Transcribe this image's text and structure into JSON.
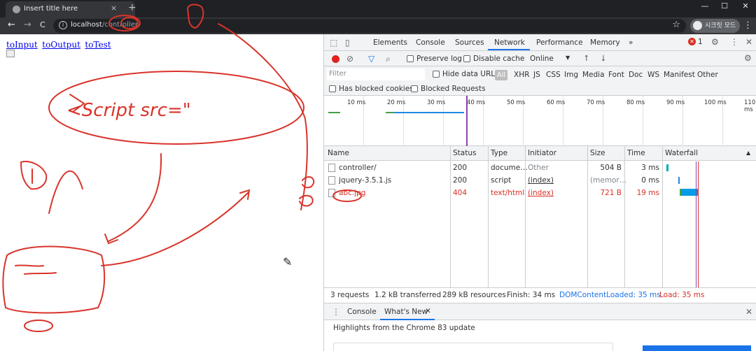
{
  "browser": {
    "tab_title": "Insert title here",
    "tab_close": "×",
    "new_tab": "+",
    "window_controls": [
      "—",
      "☐",
      "✕"
    ],
    "back": "←",
    "forward": "→",
    "reload": "C",
    "url_host": "localhost",
    "url_path": "/controller/",
    "star": "☆",
    "profile_label": "시크릿 모드",
    "menu": "⋮"
  },
  "page": {
    "links": [
      "toInput",
      "toOutput",
      "toTest"
    ]
  },
  "devtools": {
    "tabs": [
      "Elements",
      "Console",
      "Sources",
      "Network",
      "Performance",
      "Memory",
      "»"
    ],
    "selected_tab": "Network",
    "error_count": "1",
    "toolbar": {
      "preserve_log": "Preserve log",
      "disable_cache": "Disable cache",
      "throttle": "Online",
      "throttle_arrow": "▼"
    },
    "filter": {
      "placeholder": "Filter",
      "hide_data_urls": "Hide data URLs",
      "all": "All",
      "types": [
        "XHR",
        "JS",
        "CSS",
        "Img",
        "Media",
        "Font",
        "Doc",
        "WS",
        "Manifest",
        "Other"
      ],
      "has_blocked_cookies": "Has blocked cookies",
      "blocked_requests": "Blocked Requests"
    },
    "timeline_ticks": [
      "10 ms",
      "20 ms",
      "30 ms",
      "40 ms",
      "50 ms",
      "60 ms",
      "70 ms",
      "80 ms",
      "90 ms",
      "100 ms",
      "110 ms"
    ],
    "columns": [
      "Name",
      "Status",
      "Type",
      "Initiator",
      "Size",
      "Time",
      "Waterfall"
    ],
    "sort_arrow": "▲",
    "requests": [
      {
        "name": "controller/",
        "status": "200",
        "type": "docume…",
        "initiator": "Other",
        "size": "504 B",
        "time": "3 ms",
        "error": false
      },
      {
        "name": "jquery-3.5.1.js",
        "status": "200",
        "type": "script",
        "initiator": "(index)",
        "size": "(memor…",
        "time": "0 ms",
        "error": false
      },
      {
        "name": "abc.jpg",
        "status": "404",
        "type": "text/html",
        "initiator": "(index)",
        "size": "721 B",
        "time": "19 ms",
        "error": true
      }
    ],
    "status_bar": {
      "requests": "3 requests",
      "transferred": "1.2 kB transferred",
      "resources": "289 kB resources",
      "finish": "Finish: 34 ms",
      "dom_loaded": "DOMContentLoaded: 35 ms",
      "load": "Load: 35 ms"
    },
    "drawer": {
      "tabs": [
        "Console",
        "What's New"
      ],
      "close": "✕",
      "highlight": "Highlights from the Chrome 83 update"
    },
    "colors": {
      "dom_loaded": "#1a73e8",
      "load": "#d93025",
      "error": "#d93025"
    }
  },
  "annotations": {
    "note1": "<Script src=\"",
    "stroke_color": "#d9342b"
  }
}
